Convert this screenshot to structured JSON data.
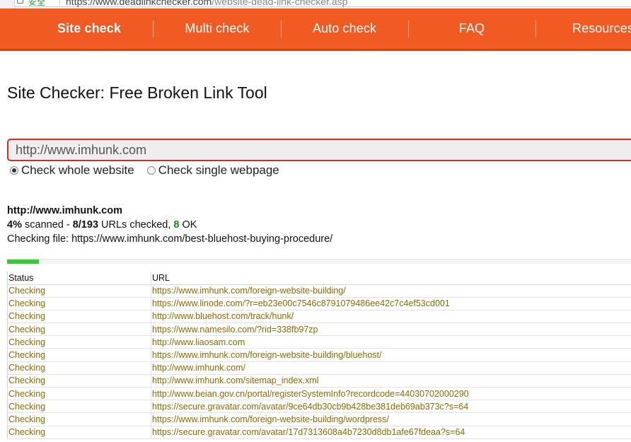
{
  "browser": {
    "secure_label": "安全",
    "url_main": "https://www.deadlinkchecker.com",
    "url_path": "/website-dead-link-checker.asp"
  },
  "nav": {
    "items": [
      {
        "label": "Site check",
        "active": true
      },
      {
        "label": "Multi check",
        "active": false
      },
      {
        "label": "Auto check",
        "active": false
      },
      {
        "label": "FAQ",
        "active": false
      },
      {
        "label": "Resources",
        "active": false
      }
    ]
  },
  "page": {
    "title": "Site Checker: Free Broken Link Tool"
  },
  "form": {
    "url_value": "http://www.imhunk.com",
    "options": [
      {
        "label": "Check whole website",
        "checked": true
      },
      {
        "label": "Check single webpage",
        "checked": false
      }
    ]
  },
  "scan": {
    "host": "http://www.imhunk.com",
    "percent_text": "4%",
    "scanned_label": "scanned -",
    "checked_text": "8/193",
    "checked_label": "URLs checked,",
    "ok_count": "8",
    "ok_label": "OK",
    "checking_file_label": "Checking file:",
    "checking_file": "https://www.imhunk.com/best-bluehost-buying-procedure/",
    "progress": 0.05
  },
  "colors": {
    "nav_bg": "#f15a22",
    "input_border": "#c9302c",
    "progress_fill": "#33cc33",
    "row_text": "#8a6a00",
    "ok_green": "#1a8a1a"
  },
  "table": {
    "headers": [
      "Status",
      "URL"
    ],
    "rows": [
      {
        "status": "Checking",
        "url": "https://www.imhunk.com/foreign-website-building/"
      },
      {
        "status": "Checking",
        "url": "https://www.linode.com/?r=eb23e00c7546c8791079486ee42c7c4ef53cd001"
      },
      {
        "status": "Checking",
        "url": "http://www.bluehost.com/track/hunk/"
      },
      {
        "status": "Checking",
        "url": "https://www.namesilo.com/?rid=338fb97zp"
      },
      {
        "status": "Checking",
        "url": "http://www.liaosam.com"
      },
      {
        "status": "Checking",
        "url": "https://www.imhunk.com/foreign-website-building/bluehost/"
      },
      {
        "status": "Checking",
        "url": "http://www.imhunk.com/"
      },
      {
        "status": "Checking",
        "url": "http://www.imhunk.com/sitemap_index.xml"
      },
      {
        "status": "Checking",
        "url": "http://www.beian.gov.cn/portal/registerSystemInfo?recordcode=44030702000290"
      },
      {
        "status": "Checking",
        "url": "https://secure.gravatar.com/avatar/9ce64db30cb9b428be381deb69ab373c?s=64"
      },
      {
        "status": "Checking",
        "url": "https://www.imhunk.com/foreign-website-building/wordpress/"
      },
      {
        "status": "Checking",
        "url": "https://secure.gravatar.com/avatar/17d7313608a4b7230d8db1afe67fdeaa?s=64"
      }
    ]
  }
}
